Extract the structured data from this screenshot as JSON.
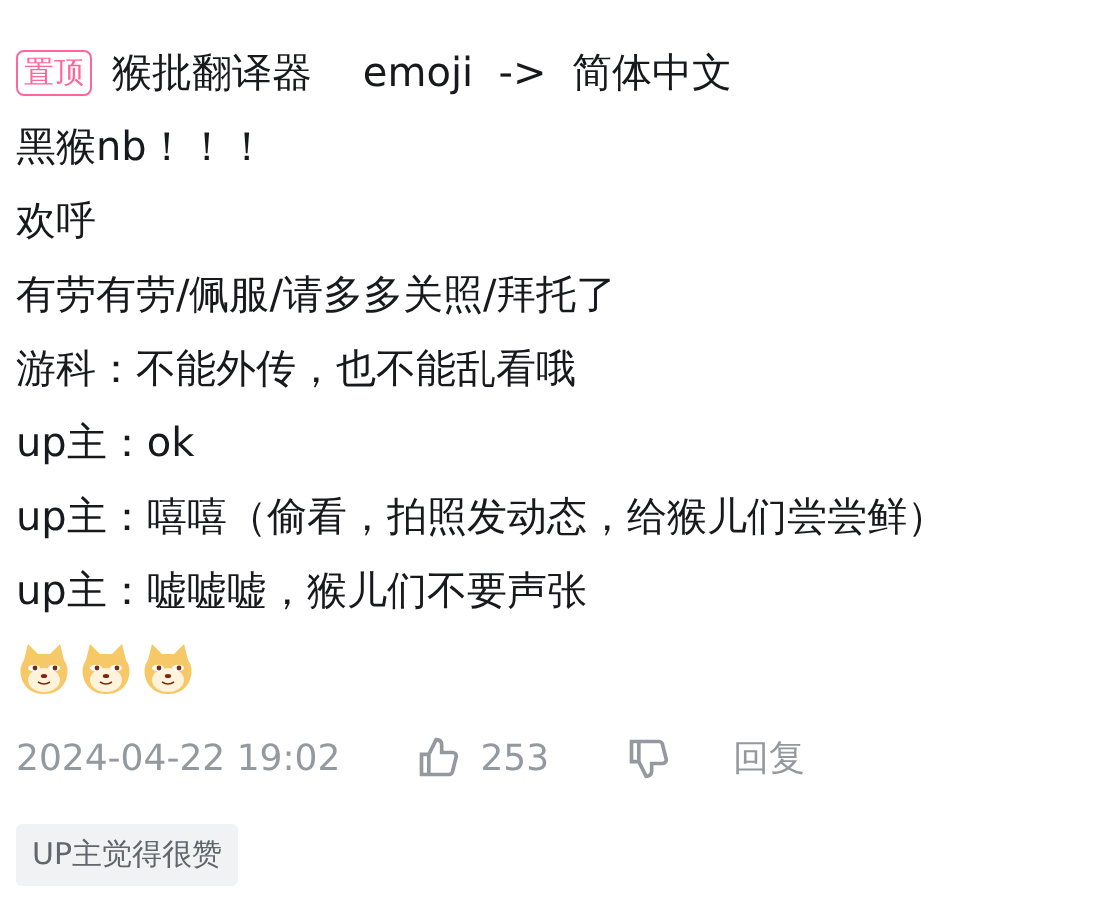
{
  "comment": {
    "pinned_badge": "置顶",
    "lines": [
      "猴批翻译器    emoji  ->  简体中文",
      "黑猴nb！！！",
      "欢呼",
      "有劳有劳/佩服/请多多关照/拜托了",
      "游科：不能外传，也不能乱看哦",
      "up主：ok",
      "up主：嘻嘻（偷看，拍照发动态，给猴儿们尝尝鲜）",
      "up主：嘘嘘嘘，猴儿们不要声张"
    ],
    "emojis": [
      {
        "kind": "doge"
      },
      {
        "kind": "doge"
      },
      {
        "kind": "doge"
      }
    ],
    "time": "2024-04-22 19:02",
    "likes": "253",
    "reply": "回复",
    "tag": "UP主觉得很赞"
  }
}
